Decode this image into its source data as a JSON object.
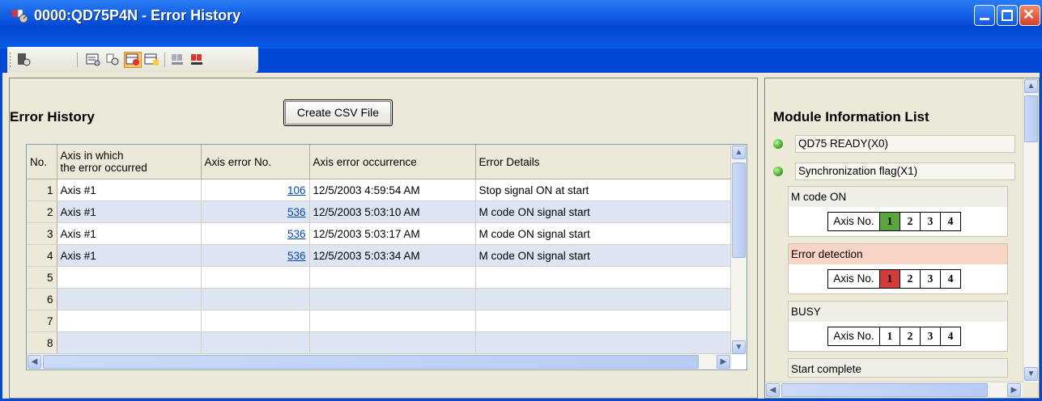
{
  "window": {
    "title": "0000:QD75P4N - Error History",
    "controls": {
      "minimize": "minimize",
      "maximize": "maximize",
      "close": "close"
    }
  },
  "toolbar": {
    "icons": [
      "monitor-tool-icon",
      "error-list-icon",
      "search-tool-icon",
      "error-history-icon",
      "warning-history-icon",
      "module-info-icon",
      "signal-info-icon"
    ]
  },
  "error_history": {
    "title": "Error History",
    "csv_button": "Create CSV File",
    "columns": [
      "No.",
      "Axis in which\n the error occurred",
      "Axis error No.",
      "Axis error occurrence",
      "Error Details"
    ],
    "rows": [
      {
        "no": "1",
        "axis": "Axis #1",
        "code": "106",
        "time": "12/5/2003 4:59:54 AM",
        "details": "Stop signal ON at start"
      },
      {
        "no": "2",
        "axis": "Axis #1",
        "code": "536",
        "time": "12/5/2003 5:03:10 AM",
        "details": "M code ON signal start"
      },
      {
        "no": "3",
        "axis": "Axis #1",
        "code": "536",
        "time": "12/5/2003 5:03:17 AM",
        "details": "M code ON signal start"
      },
      {
        "no": "4",
        "axis": "Axis #1",
        "code": "536",
        "time": "12/5/2003 5:03:34 AM",
        "details": "M code ON signal start"
      },
      {
        "no": "5",
        "axis": "",
        "code": "",
        "time": "",
        "details": ""
      },
      {
        "no": "6",
        "axis": "",
        "code": "",
        "time": "",
        "details": ""
      },
      {
        "no": "7",
        "axis": "",
        "code": "",
        "time": "",
        "details": ""
      },
      {
        "no": "8",
        "axis": "",
        "code": "",
        "time": "",
        "details": ""
      }
    ]
  },
  "module_info": {
    "title": "Module Information List",
    "signals": [
      {
        "label": "QD75 READY(X0)",
        "state": "on"
      },
      {
        "label": "Synchronization flag(X1)",
        "state": "on"
      }
    ],
    "blocks": [
      {
        "label": "M code ON",
        "axis_label": "Axis No.",
        "axes": [
          "1",
          "2",
          "3",
          "4"
        ],
        "active_axis": "1",
        "active_color": "#59a63b"
      },
      {
        "label": "Error detection",
        "axis_label": "Axis No.",
        "axes": [
          "1",
          "2",
          "3",
          "4"
        ],
        "active_axis": "1",
        "active_color": "#d23b3b"
      },
      {
        "label": "BUSY",
        "axis_label": "Axis No.",
        "axes": [
          "1",
          "2",
          "3",
          "4"
        ],
        "active_axis": "",
        "active_color": ""
      }
    ],
    "partial_item": "Start complete"
  },
  "colors": {
    "titlebar": "#0a52dc",
    "selected_row": "#dde4f2",
    "green_led": "#3a9b1e",
    "error_bg": "#f9d3c6"
  }
}
